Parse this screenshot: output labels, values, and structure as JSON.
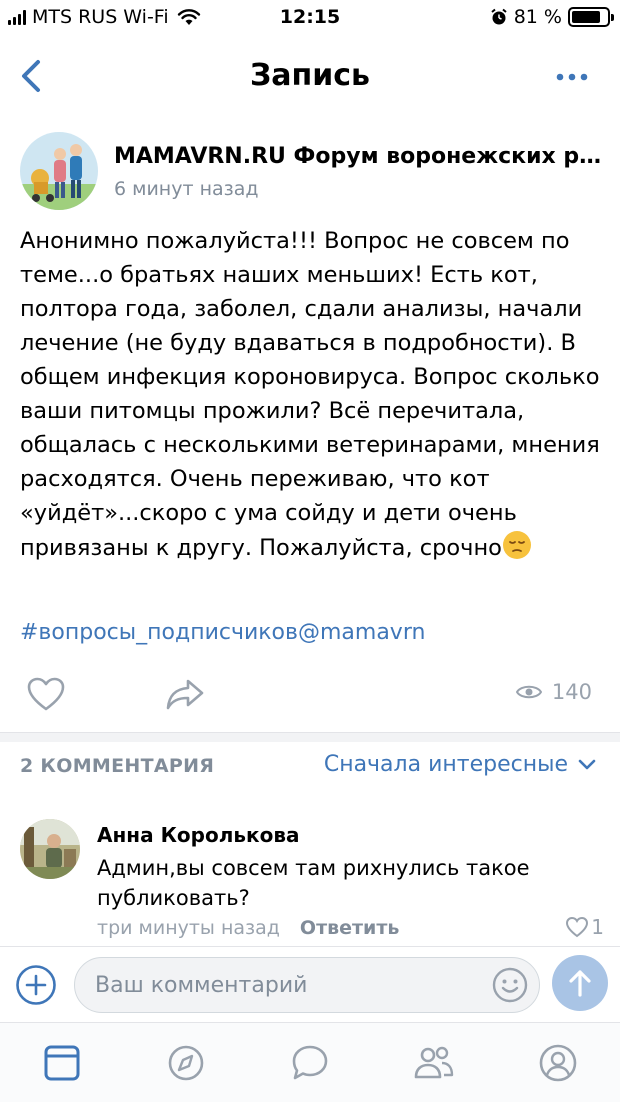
{
  "status_bar": {
    "carrier": "MTS RUS Wi-Fi",
    "time": "12:15",
    "battery_percent": "81 %",
    "battery_level": 0.81
  },
  "nav": {
    "title": "Запись",
    "back_icon": "chevron-left-icon",
    "more_icon": "more-horizontal-icon"
  },
  "post": {
    "community_name": "MAMAVRN.RU Форум воронежских ро...",
    "time": "6 минут назад",
    "text": "Анонимно пожалуйста!!! Вопрос не совсем по теме...о братьях наших меньших! Есть кот, полтора года, заболел, сдали анализы, начали лечение (не буду вдаваться в подробности). В общем инфекция короновируса. Вопрос сколько ваши питомцы прожили? Всё перечитала, общалась с несколькими ветеринарами, мнения расходятся. Очень переживаю, что кот «уйдёт»...скоро с ума сойду и дети очень привязаны к другу. Пожалуйста, срочно",
    "hashtag": "#вопросы_подписчиков@mamavrn",
    "views": "140"
  },
  "comments": {
    "count_label": "2 КОММЕНТАРИЯ",
    "sort_label": "Сначала интересные",
    "items": [
      {
        "author": "Анна Королькова",
        "text": "Админ,вы совсем там рихнулись такое публиковать?",
        "time": "три минуты назад",
        "reply_label": "Ответить",
        "likes": "1"
      }
    ]
  },
  "composer": {
    "placeholder": "Ваш комментарий"
  },
  "tabs": [
    "news-icon",
    "discover-icon",
    "messages-icon",
    "friends-icon",
    "profile-icon"
  ],
  "colors": {
    "accent": "#3f76b8",
    "icon_gray": "#99a2ad",
    "send_button": "#a9c4e5"
  }
}
